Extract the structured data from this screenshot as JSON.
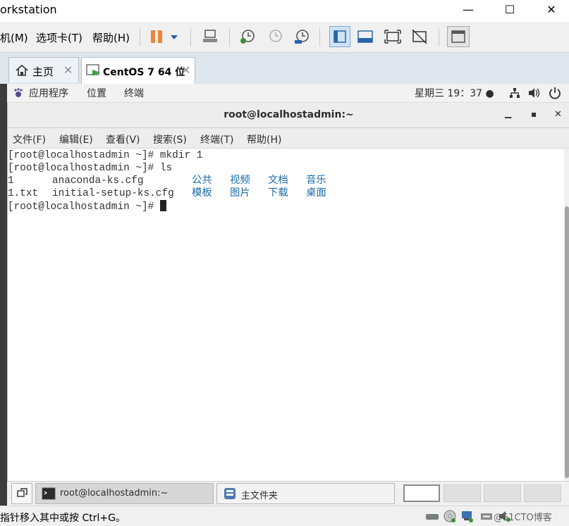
{
  "window": {
    "title": "orkstation",
    "minimize": "—",
    "maximize": "☐",
    "close": "✕"
  },
  "menubar": {
    "items": [
      "机(M)",
      "选项卡(T)",
      "帮助(H)"
    ]
  },
  "tabs": [
    {
      "label": "主页",
      "close": "✕",
      "icon": "home-icon"
    },
    {
      "label": "CentOS 7 64 位",
      "close": "✕",
      "icon": "vm-icon"
    }
  ],
  "gnome_top": {
    "apps": "应用程序",
    "places": "位置",
    "terminal": "终端",
    "clock": "星期三 19：37 ●"
  },
  "terminal": {
    "title": "root@localhostadmin:~",
    "min": "▁",
    "max": "▪",
    "close": "✕",
    "menu": [
      "文件(F)",
      "编辑(E)",
      "查看(V)",
      "搜索(S)",
      "终端(T)",
      "帮助(H)"
    ],
    "lines": [
      "[root@localhostadmin ~]# mkdir 1",
      "[root@localhostadmin ~]# ls",
      "[root@localhostadmin ~]# "
    ],
    "ls_row1": {
      "plain": [
        "1",
        "anaconda-ks.cfg"
      ],
      "dirs": [
        "公共",
        "视频",
        "文档",
        "音乐"
      ]
    },
    "ls_row2": {
      "plain": [
        "1.txt",
        "initial-setup-ks.cfg"
      ],
      "dirs": [
        "模板",
        "图片",
        "下载",
        "桌面"
      ]
    }
  },
  "bottom_panel": {
    "task1": "root@localhostadmin:~",
    "task2": "主文件夹"
  },
  "statusbar": {
    "hint": "指针移入其中或按 Ctrl+G。",
    "watermark": "@51CTO博客"
  }
}
